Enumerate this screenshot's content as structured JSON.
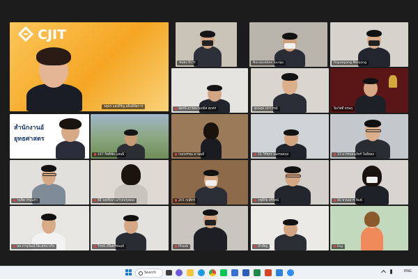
{
  "presenter": {
    "logo_text": "CJIT",
    "name": "จตุพร แสงพิรัญ อธิบดีอัยการ",
    "slide_line1": "สำนักงานอั",
    "slide_line2": "ยุทธศาสตร"
  },
  "participants": [
    {
      "name": "ชนชง สิวาร"
    },
    {
      "name": "Noraboddee Surajo"
    },
    {
      "name": "Rapeepong Meejang"
    },
    {
      "name": "ฉัตรนี สารสนามทมิส ศุภคร"
    },
    {
      "name": "ฐปนฤม ปภาวรณ์"
    },
    {
      "name": "นิลวัสดิ์ ตรมฤ"
    },
    {
      "name": "197 กิตติชัย แสนพี"
    },
    {
      "name": "กนกพรรณ มานพดี"
    },
    {
      "name": "55 วิรัชกร หลงรอดกุล"
    },
    {
      "name": "23 ธวรรษธนภัทร์ โพธิ์ทอง"
    },
    {
      "name": "วนุชิต กรมแก้ว"
    },
    {
      "name": "ธิธี จงหรีเพา แก้วทบรุ่งทอง"
    },
    {
      "name": "201 กฤติกร"
    },
    {
      "name": "ฤชุติกัย ตรีรัตน์"
    },
    {
      "name": "60 ทวนณาร พิมพ์"
    },
    {
      "name": "นพ ภานุวัฒน์ ปิยะสุรนางใจ"
    },
    {
      "name": "วิรจน์ ภงิ๊นตรีชนฤย์"
    },
    {
      "name": "Phoob"
    },
    {
      "name": "บำเพ็ญ"
    },
    {
      "name": "Eay"
    }
  ],
  "taskbar": {
    "search_label": "Search",
    "language": "ENG",
    "icons": [
      "windows-start-icon",
      "taskview-icon",
      "chat-icon",
      "explorer-icon",
      "edge-icon",
      "chrome-icon",
      "line-icon",
      "store-icon",
      "word-icon",
      "excel-icon",
      "powerpoint-icon",
      "mail-icon",
      "zoom-icon"
    ]
  },
  "colors": {
    "meeting_bg": "#1c1c1c",
    "presenter_bg": "#f4a71c",
    "taskbar_bg": "#eef1f6"
  }
}
